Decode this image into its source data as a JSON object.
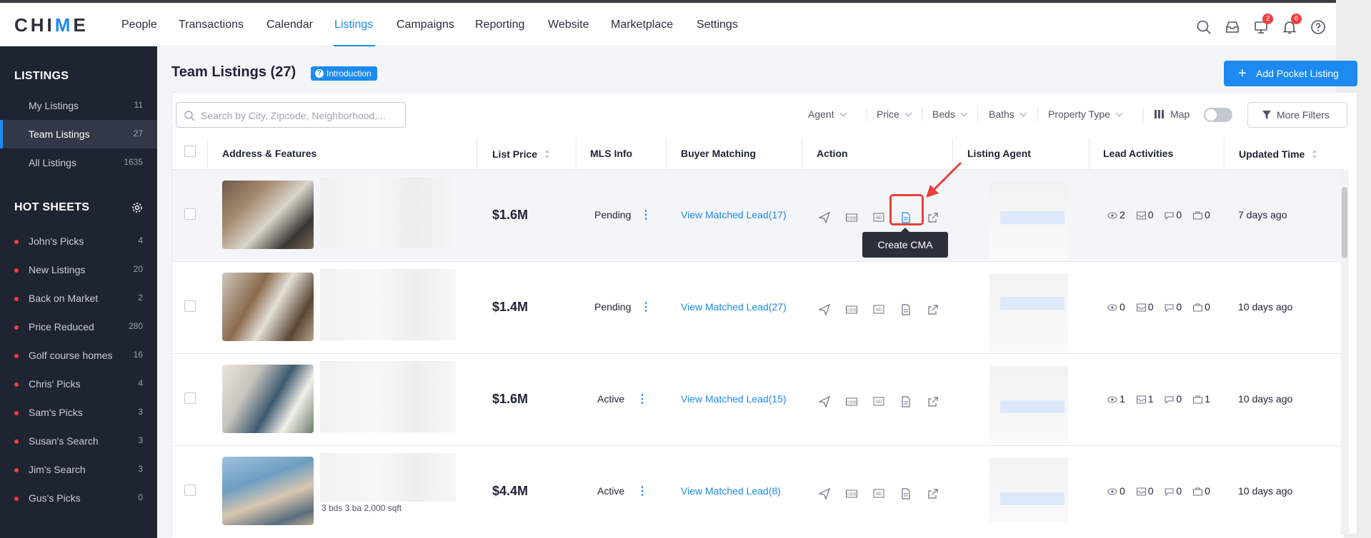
{
  "app": {
    "logo_pre": "CHI",
    "logo_accent": "M",
    "logo_post": "E"
  },
  "nav": {
    "items": [
      "People",
      "Transactions",
      "Calendar",
      "Listings",
      "Campaigns",
      "Reporting",
      "Website",
      "Marketplace",
      "Settings"
    ],
    "active": "Listings",
    "badges": {
      "messages": "2",
      "notifications": "6"
    }
  },
  "sidebar": {
    "listings_heading": "LISTINGS",
    "listings": [
      {
        "label": "My Listings",
        "count": "11"
      },
      {
        "label": "Team Listings",
        "count": "27"
      },
      {
        "label": "All Listings",
        "count": "1635"
      }
    ],
    "hot_heading": "HOT SHEETS",
    "hot_sheets": [
      {
        "label": "John's Picks",
        "count": "4"
      },
      {
        "label": "New Listings",
        "count": "20"
      },
      {
        "label": "Back on Market",
        "count": "2"
      },
      {
        "label": "Price Reduced",
        "count": "280"
      },
      {
        "label": "Golf course homes",
        "count": "16"
      },
      {
        "label": "Chris' Picks",
        "count": "4"
      },
      {
        "label": "Sam's Picks",
        "count": "3"
      },
      {
        "label": "Susan's Search",
        "count": "3"
      },
      {
        "label": "Jim's Search",
        "count": "3"
      },
      {
        "label": "Gus's Picks",
        "count": "0"
      }
    ]
  },
  "page": {
    "title": "Team Listings (27)",
    "intro_label": "Introduction",
    "add_button": "Add Pocket Listing",
    "search_placeholder": "Search by City, Zipcode, Neighborhood,...",
    "filters": {
      "agent": "Agent",
      "price": "Price",
      "beds": "Beds",
      "baths": "Baths",
      "property_type": "Property Type",
      "map": "Map",
      "more": "More Filters"
    }
  },
  "table": {
    "headers": {
      "address": "Address & Features",
      "price": "List Price",
      "mls": "MLS Info",
      "buyer": "Buyer Matching",
      "action": "Action",
      "agent": "Listing Agent",
      "lead": "Lead Activities",
      "updated": "Updated Time"
    },
    "rows": [
      {
        "price": "$1.6M",
        "status": "Pending",
        "match": "View Matched Lead(17)",
        "views": "2",
        "saves": "0",
        "comments": "0",
        "shares": "0",
        "updated": "7 days ago"
      },
      {
        "price": "$1.4M",
        "status": "Pending",
        "match": "View Matched Lead(27)",
        "views": "0",
        "saves": "0",
        "comments": "0",
        "shares": "0",
        "updated": "10 days ago"
      },
      {
        "price": "$1.6M",
        "status": "Active",
        "match": "View Matched Lead(15)",
        "views": "1",
        "saves": "1",
        "comments": "0",
        "shares": "1",
        "updated": "10 days ago"
      },
      {
        "price": "$4.4M",
        "status": "Active",
        "match": "View Matched Lead(8)",
        "views": "0",
        "saves": "0",
        "comments": "0",
        "shares": "0",
        "updated": "10 days ago",
        "features": "3 bds 3 ba 2,000 sqft"
      }
    ],
    "tooltip": "Create CMA"
  },
  "colors": {
    "accent": "#1d8af2",
    "sidebar_bg": "#1f2433",
    "badge": "#f43d3d",
    "highlight": "#e8413b"
  }
}
